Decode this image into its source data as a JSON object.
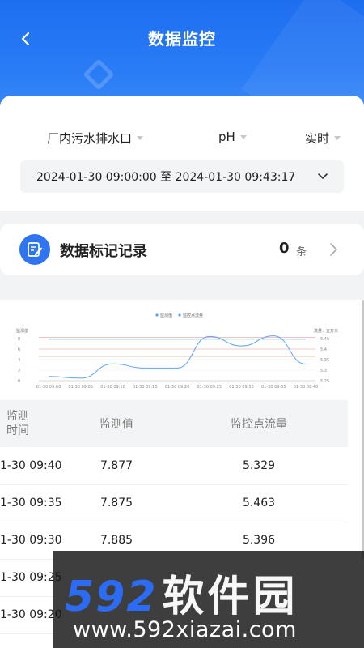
{
  "header": {
    "title": "数据监控",
    "back_icon": "chevron-left-icon"
  },
  "filters": {
    "outlet": "厂内污水排水口",
    "parameter": "pH",
    "mode": "实时",
    "date_range": "2024-01-30 09:00:00 至 2024-01-30 09:43:17"
  },
  "record": {
    "title": "数据标记记录",
    "count": "0",
    "unit": "条",
    "icon": "edit-note-icon"
  },
  "chart_data": {
    "type": "line",
    "legend": [
      "监测值",
      "监控点流量"
    ],
    "ylabel_left": "监测值",
    "ylabel_right": "流量：立方米",
    "x": [
      "01-30 09:00",
      "01-30 09:05",
      "01-30 09:10",
      "01-30 09:15",
      "01-30 09:20",
      "01-30 09:25",
      "01-30 09:30",
      "01-30 09:35",
      "01-30 09:40"
    ],
    "y_left_ticks": [
      "0",
      "2",
      "4",
      "6",
      "8"
    ],
    "y_right_ticks": [
      "5.25",
      "5.3",
      "5.35",
      "5.4",
      "5.45"
    ],
    "ylim_left": [
      0,
      8
    ],
    "ylim_right": [
      5.25,
      5.45
    ],
    "series": [
      {
        "name": "监测值",
        "axis": "left",
        "color": "#5ea4f3",
        "values": [
          7.88,
          7.88,
          7.88,
          7.88,
          7.88,
          7.88,
          7.885,
          7.875,
          7.877
        ]
      },
      {
        "name": "监控点流量",
        "axis": "right",
        "color": "#5ea4f3",
        "values": [
          5.27,
          5.262,
          5.33,
          5.31,
          5.31,
          5.46,
          5.415,
          5.463,
          5.329
        ]
      }
    ],
    "reference_lines_left": [
      8.2,
      6.0,
      5.5,
      4.5
    ]
  },
  "table": {
    "headers": [
      "监测\n时间",
      "监测值",
      "监控点流量"
    ],
    "rows": [
      [
        "1-30 09:40",
        "7.877",
        "5.329"
      ],
      [
        "1-30 09:35",
        "7.875",
        "5.463"
      ],
      [
        "1-30 09:30",
        "7.885",
        "5.396"
      ],
      [
        "1-30 09:25",
        "",
        ""
      ],
      [
        "1-30 09:20",
        "",
        ""
      ]
    ]
  },
  "watermark": {
    "logo_num": "592",
    "logo_cn": "软件园",
    "url": "www.592xiazai.com"
  }
}
